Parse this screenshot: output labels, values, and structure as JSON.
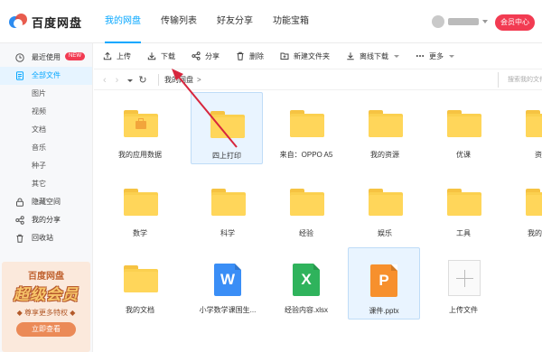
{
  "header": {
    "logo_text": "百度网盘",
    "tabs": [
      {
        "label": "我的网盘",
        "active": true
      },
      {
        "label": "传输列表",
        "active": false
      },
      {
        "label": "好友分享",
        "active": false
      },
      {
        "label": "功能宝箱",
        "active": false
      }
    ],
    "vip_button": "会员中心"
  },
  "sidebar": {
    "items": [
      {
        "label": "最近使用",
        "icon": "clock-icon",
        "badge": "NEW"
      },
      {
        "label": "全部文件",
        "icon": "file-icon",
        "active": true
      }
    ],
    "categories": [
      "图片",
      "视频",
      "文档",
      "音乐",
      "种子",
      "其它"
    ],
    "bottom_items": [
      {
        "label": "隐藏空间",
        "icon": "lock-icon"
      },
      {
        "label": "我的分享",
        "icon": "share-icon"
      },
      {
        "label": "回收站",
        "icon": "trash-icon"
      }
    ],
    "promo": {
      "title": "百度网盘",
      "headline": "超级会员",
      "subtitle": "◆ 尊享更多特权 ◆",
      "button": "立即查看"
    }
  },
  "toolbar": {
    "upload": "上传",
    "download": "下载",
    "share": "分享",
    "delete": "删除",
    "new_folder": "新建文件夹",
    "offline_download": "离线下载",
    "more": "更多"
  },
  "addressbar": {
    "path": "我的网盘",
    "path_sep": ">",
    "search_placeholder": "搜索我的文件"
  },
  "files": [
    {
      "name": "我的应用数据",
      "type": "folder-app"
    },
    {
      "name": "四上打印",
      "type": "folder",
      "selected": true
    },
    {
      "name": "来自：OPPO A5",
      "type": "folder"
    },
    {
      "name": "我的资源",
      "type": "folder"
    },
    {
      "name": "优课",
      "type": "folder"
    },
    {
      "name": "资料",
      "type": "folder"
    },
    {
      "name": "数学",
      "type": "folder"
    },
    {
      "name": "科学",
      "type": "folder"
    },
    {
      "name": "经验",
      "type": "folder"
    },
    {
      "name": "娱乐",
      "type": "folder"
    },
    {
      "name": "工具",
      "type": "folder"
    },
    {
      "name": "我的网盘",
      "type": "folder"
    },
    {
      "name": "我的文档",
      "type": "folder"
    },
    {
      "name": "小学数学课国生...",
      "type": "word",
      "letter": "W"
    },
    {
      "name": "经验内容.xlsx",
      "type": "excel",
      "letter": "X"
    },
    {
      "name": "课件.pptx",
      "type": "ppt",
      "letter": "P",
      "selected": true
    },
    {
      "name": "上传文件",
      "type": "upload"
    }
  ],
  "colors": {
    "accent": "#06a7ff",
    "vip": "#f23b52",
    "word": "#3a8ef6",
    "excel": "#2fb35c",
    "ppt": "#f7902d",
    "annotation_arrow": "#d7263d"
  }
}
